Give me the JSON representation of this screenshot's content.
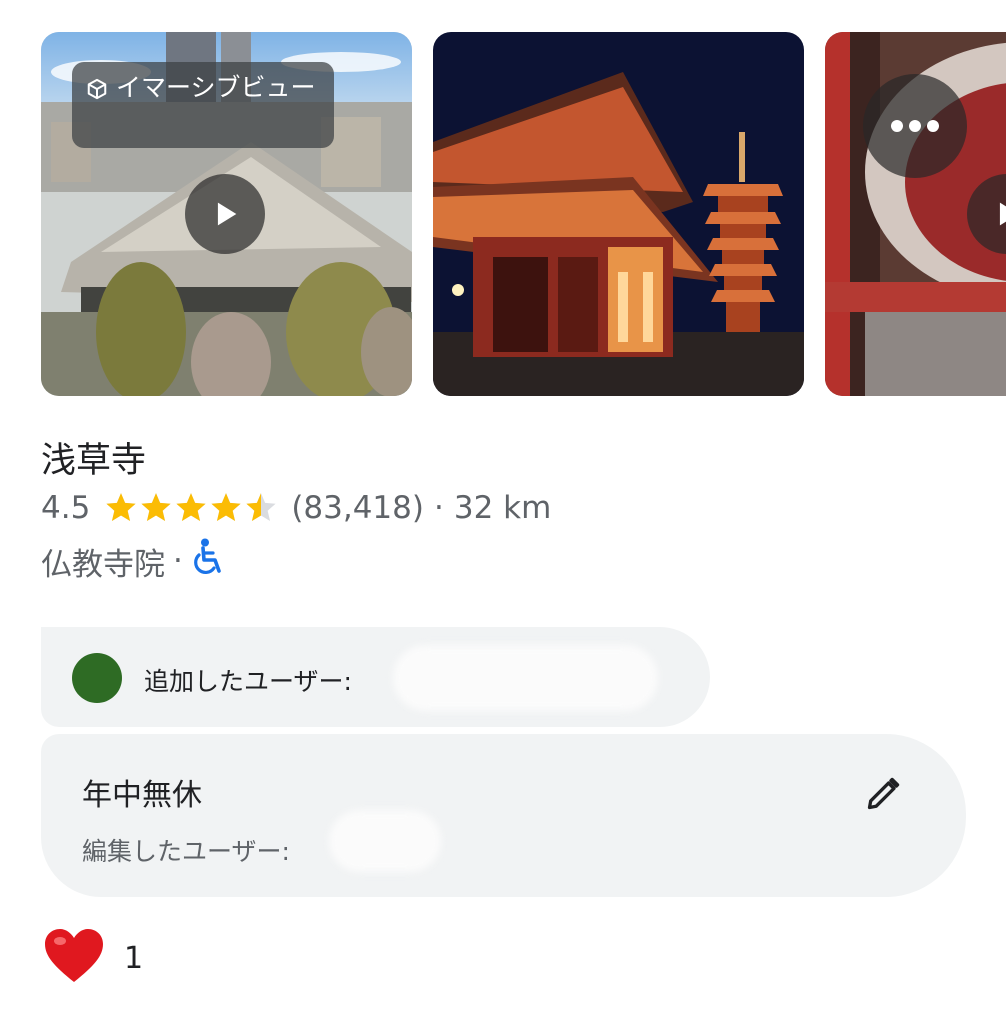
{
  "photos": {
    "immersive_label": "イマーシブビュー",
    "icons": {
      "immersive": "cube-icon",
      "play": "play-icon",
      "more": "more-horiz-icon"
    }
  },
  "place": {
    "name": "浅草寺",
    "rating": "4.5",
    "rating_value": 4.5,
    "rating_max": 5,
    "review_count": "(83,418)",
    "separator": "·",
    "distance": "32 km",
    "category": "仏教寺院",
    "accessibility_icon": "wheelchair-icon"
  },
  "colors": {
    "star": "#fbbc04",
    "accessibility": "#1a73e8",
    "avatar": "#2e6b24",
    "card": "#f1f3f4",
    "heart": "#e0181f"
  },
  "added_by": {
    "label": "追加したユーザー:"
  },
  "note": {
    "title": "年中無休",
    "edited_label": "編集したユーザー:",
    "edit_icon": "pencil-icon"
  },
  "reactions": {
    "icon": "heart-icon",
    "count": "1"
  }
}
